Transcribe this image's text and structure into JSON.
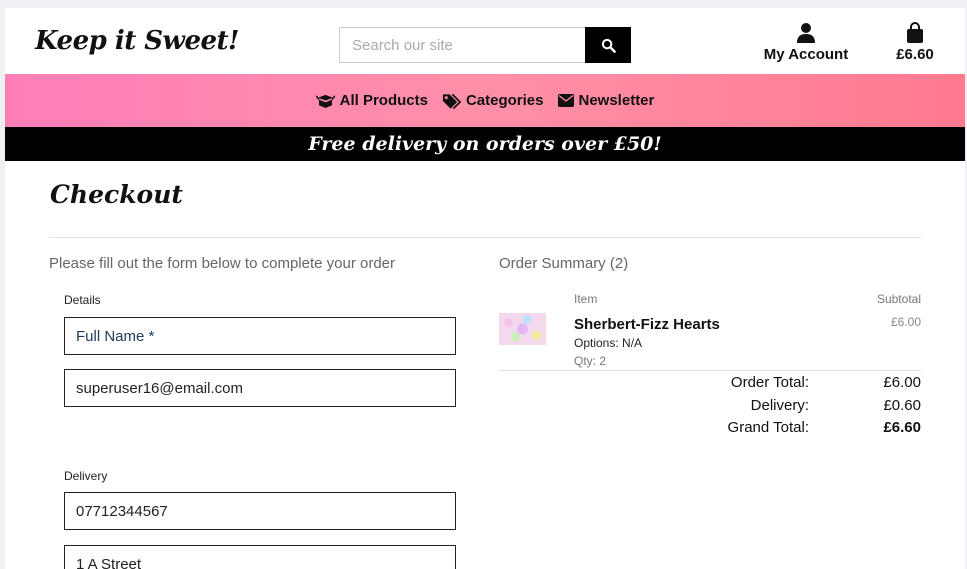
{
  "header": {
    "logo": "Keep it Sweet!",
    "search_placeholder": "Search our site",
    "account_label": "My Account",
    "bag_total": "£6.60"
  },
  "nav": {
    "items": [
      {
        "label": "All Products",
        "icon": "box-open-icon"
      },
      {
        "label": "Categories",
        "icon": "tags-icon"
      },
      {
        "label": "Newsletter",
        "icon": "envelope-icon"
      }
    ]
  },
  "banner": {
    "text": "Free delivery on orders over £50!"
  },
  "checkout": {
    "title": "Checkout",
    "intro": "Please fill out the form below to complete your order",
    "details_legend": "Details",
    "full_name_placeholder": "Full Name *",
    "email_value": "superuser16@email.com",
    "delivery_legend": "Delivery",
    "phone_value": "07712344567",
    "street_value": "1 A Street"
  },
  "summary": {
    "title": "Order Summary (2)",
    "col_item": "Item",
    "col_subtotal": "Subtotal",
    "product": {
      "name": "Sherbert-Fizz Hearts",
      "options": "Options: N/A",
      "qty": "Qty: 2",
      "subtotal": "£6.00"
    },
    "order_total_label": "Order Total:",
    "order_total_value": "£6.00",
    "delivery_label": "Delivery:",
    "delivery_value": "£0.60",
    "grand_total_label": "Grand Total:",
    "grand_total_value": "£6.60"
  },
  "colors": {
    "nav_gradient_start": "#ff7eb8",
    "nav_gradient_end": "#ff7a8f",
    "banner_bg": "#000000"
  }
}
